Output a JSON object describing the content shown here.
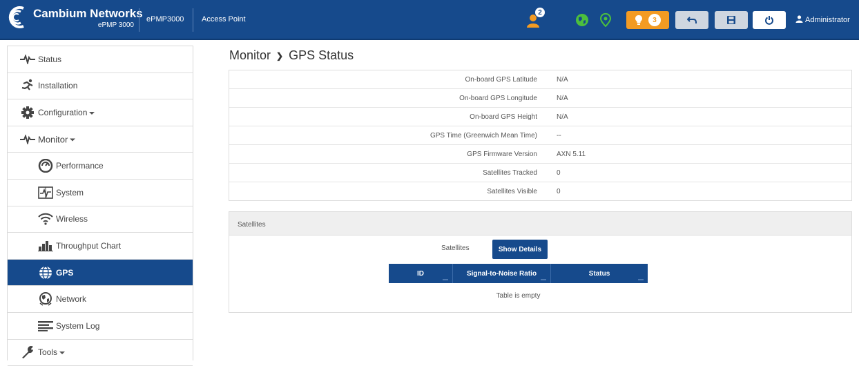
{
  "header": {
    "brand": "Cambium Networks",
    "model": "ePMP 3000",
    "device": "ePMP3000",
    "mode": "Access Point",
    "users_count": "2",
    "alerts_count": "3",
    "user": "Administrator",
    "colors": {
      "bar": "#164a8c",
      "accent_green": "#4cbf3d",
      "alert_orange": "#f39b23"
    },
    "icons": [
      "users-icon",
      "globe-icon",
      "location-pin-icon",
      "lightbulb-icon",
      "undo-icon",
      "save-icon",
      "power-icon",
      "user-icon"
    ]
  },
  "sidebar": {
    "items": [
      {
        "label": "Status",
        "icon": "pulse-icon"
      },
      {
        "label": "Installation",
        "icon": "runner-icon"
      },
      {
        "label": "Configuration",
        "icon": "gear-icon"
      },
      {
        "label": "Monitor",
        "icon": "pulse-icon"
      },
      {
        "label": "Performance",
        "icon": "speedometer-icon"
      },
      {
        "label": "System",
        "icon": "system-monitor-icon"
      },
      {
        "label": "Wireless",
        "icon": "wifi-icon"
      },
      {
        "label": "Throughput Chart",
        "icon": "bar-chart-icon"
      },
      {
        "label": "GPS",
        "icon": "globe-icon"
      },
      {
        "label": "Network",
        "icon": "network-globe-icon"
      },
      {
        "label": "System Log",
        "icon": "list-lines-icon"
      },
      {
        "label": "Tools",
        "icon": "wrench-icon"
      }
    ]
  },
  "main": {
    "breadcrumb": {
      "section": "Monitor",
      "page": "GPS Status"
    },
    "gps": [
      {
        "label": "On-board GPS Latitude",
        "value": "N/A"
      },
      {
        "label": "On-board GPS Longitude",
        "value": "N/A"
      },
      {
        "label": "On-board GPS Height",
        "value": "N/A"
      },
      {
        "label": "GPS Time (Greenwich Mean Time)",
        "value": "--"
      },
      {
        "label": "GPS Firmware Version",
        "value": "AXN 5.11"
      },
      {
        "label": "Satellites Tracked",
        "value": "0"
      },
      {
        "label": "Satellites Visible",
        "value": "0"
      }
    ],
    "satellites": {
      "title": "Satellites",
      "label": "Satellites",
      "show_details": "Show Details",
      "columns": [
        "ID",
        "Signal-to-Noise Ratio",
        "Status"
      ],
      "empty": "Table is empty"
    }
  }
}
